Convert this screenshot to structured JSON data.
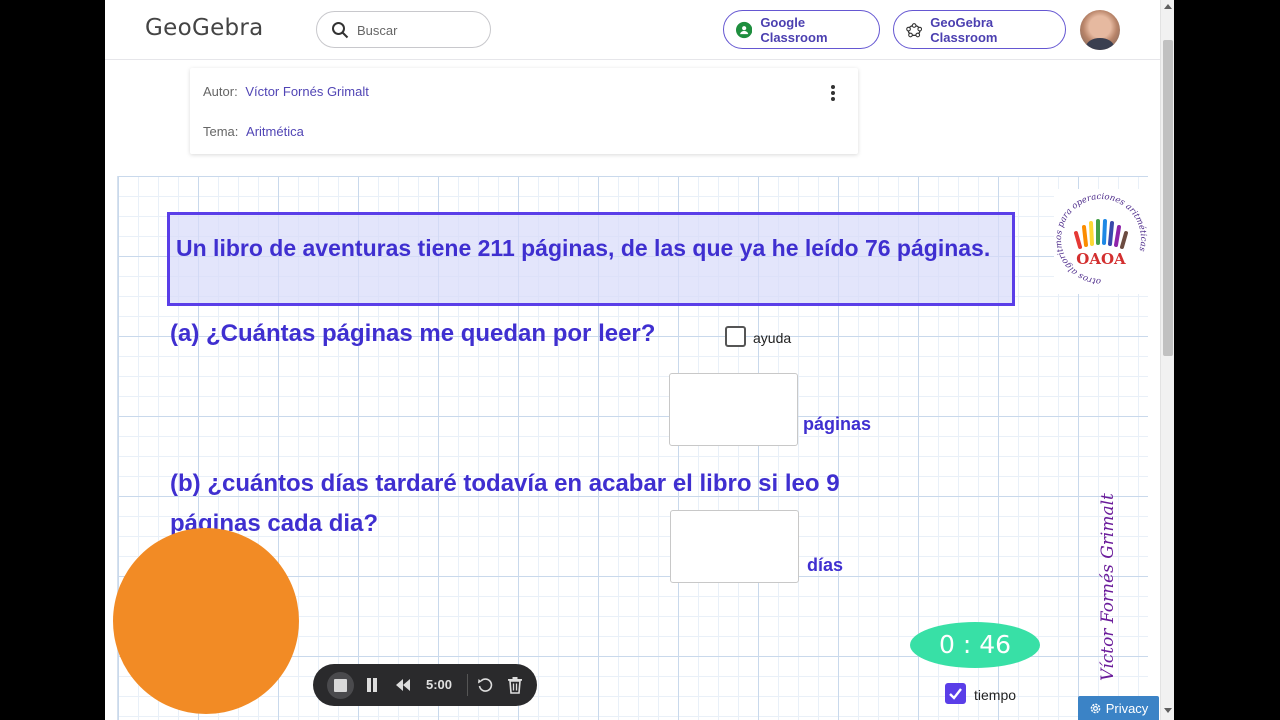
{
  "header": {
    "logo": "GeoGebra",
    "search_placeholder": "Buscar",
    "google_classroom": "Google Classroom",
    "geogebra_classroom": "GeoGebra Classroom"
  },
  "info": {
    "autor_label": "Autor:",
    "autor_value": "Víctor Fornés Grimalt",
    "tema_label": "Tema:",
    "tema_value": "Aritmética"
  },
  "applet": {
    "problem": "Un libro de aventuras tiene 211 páginas, de las que ya he leído  76 páginas.",
    "question_a": "(a) ¿Cuántas páginas me quedan por leer?",
    "help_label": "ayuda",
    "help_checked": false,
    "unit_a": "páginas",
    "question_b": "(b) ¿cuántos días tardaré todavía en acabar el libro si leo 9 páginas cada dia?",
    "unit_b": "días",
    "logo_text": "OAOA",
    "logo_ring_text": "otros algoritmos para operaciones aritméticas",
    "signature": "Víctor Fornés Grimalt",
    "timer": "0 : 46",
    "time_label": "tiempo",
    "time_checked": true
  },
  "recorder": {
    "time": "5:00"
  },
  "privacy": "Privacy",
  "colors": {
    "accent": "#5a3ee8",
    "question_text": "#3f2fd0",
    "timer": "#38e0a6",
    "circle": "#f28b25"
  }
}
